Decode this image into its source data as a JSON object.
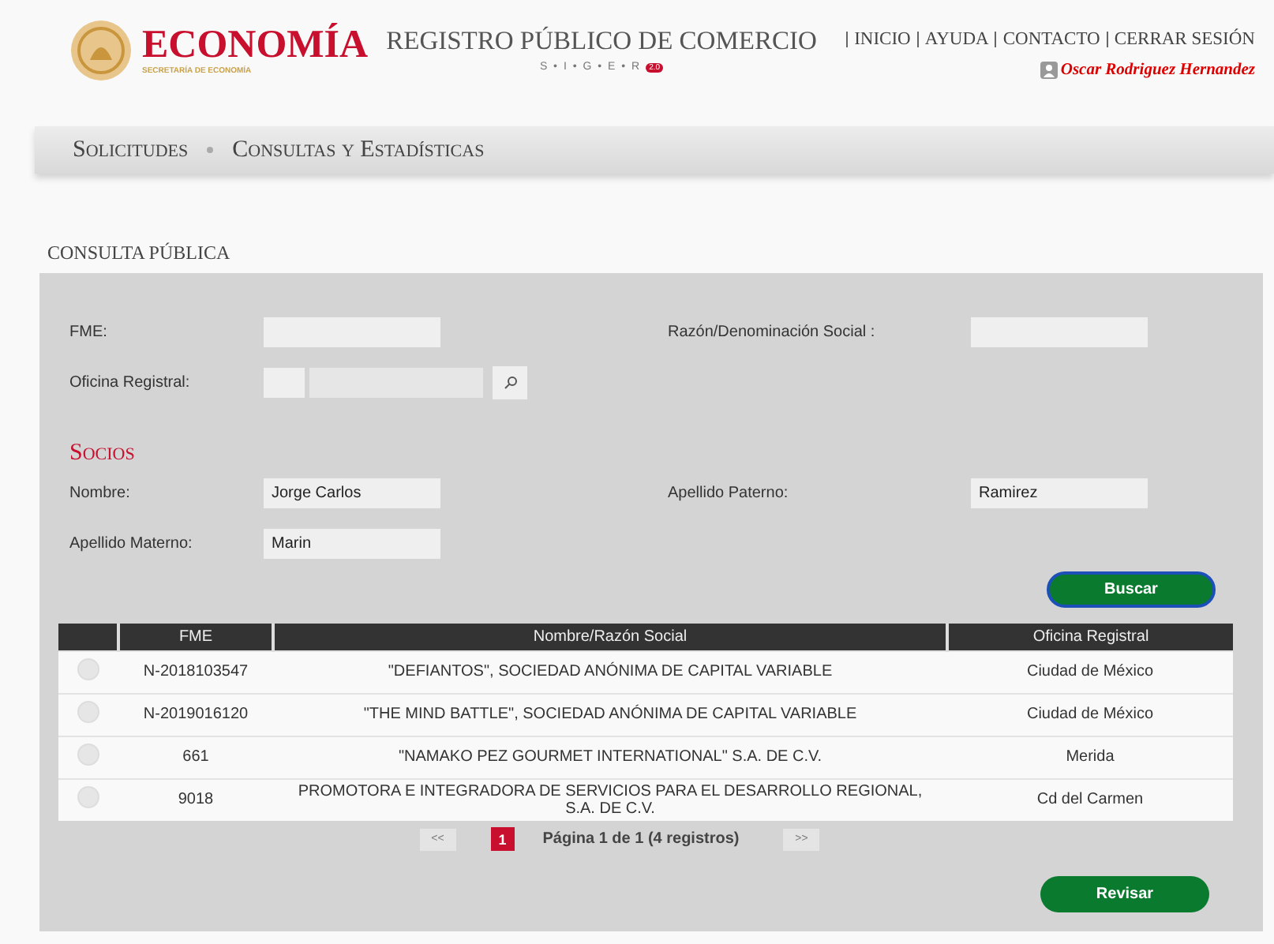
{
  "header": {
    "logo_title": "ECONOMÍA",
    "logo_subtitle": "SECRETARÍA DE ECONOMÍA",
    "app_title": "REGISTRO PÚBLICO DE COMERCIO",
    "app_letters": "S • I • G • E • R",
    "app_version": "2.0",
    "links": [
      "INICIO",
      "AYUDA",
      "CONTACTO",
      "CERRAR SESIÓN"
    ],
    "user": "Oscar Rodriguez Hernandez"
  },
  "nav": [
    "Solicitudes",
    "Consultas y Estadísticas"
  ],
  "section_title": "CONSULTA PÚBLICA",
  "form": {
    "fme": {
      "label": "FME:"
    },
    "razon": {
      "label": "Razón/Denominación Social :"
    },
    "oficina": {
      "label": "Oficina Registral:"
    },
    "socios_title": "Socios",
    "nombre": {
      "label": "Nombre:",
      "value": "Jorge Carlos"
    },
    "paterno": {
      "label": "Apellido Paterno:",
      "value": "Ramirez"
    },
    "materno": {
      "label": "Apellido Materno:",
      "value": "Marin"
    },
    "search_button": "Buscar"
  },
  "table": {
    "columns": [
      "FME",
      "Nombre/Razón Social",
      "Oficina Registral"
    ],
    "rows": [
      {
        "selected": false,
        "fme": "N-2018103547",
        "name": "\"DEFIANTOS\", SOCIEDAD ANÓNIMA DE CAPITAL VARIABLE",
        "office": "Ciudad de México"
      },
      {
        "selected": false,
        "fme": "N-2019016120",
        "name": "\"THE MIND BATTLE\", SOCIEDAD ANÓNIMA DE CAPITAL VARIABLE",
        "office": "Ciudad de México"
      },
      {
        "selected": false,
        "fme": "661",
        "name": "\"NAMAKO PEZ GOURMET INTERNATIONAL\" S.A. DE C.V.",
        "office": "Merida"
      },
      {
        "selected": false,
        "fme": "9018",
        "name": "PROMOTORA E INTEGRADORA DE SERVICIOS PARA EL DESARROLLO REGIONAL, S.A. DE C.V.",
        "office": "Cd del Carmen"
      }
    ]
  },
  "pagination": {
    "prev": "<<",
    "pages": [
      {
        "label": "1",
        "selected": true
      }
    ],
    "info": "Página 1 de 1 (4 registros)",
    "next": ">>"
  },
  "review_button": "Revisar"
}
